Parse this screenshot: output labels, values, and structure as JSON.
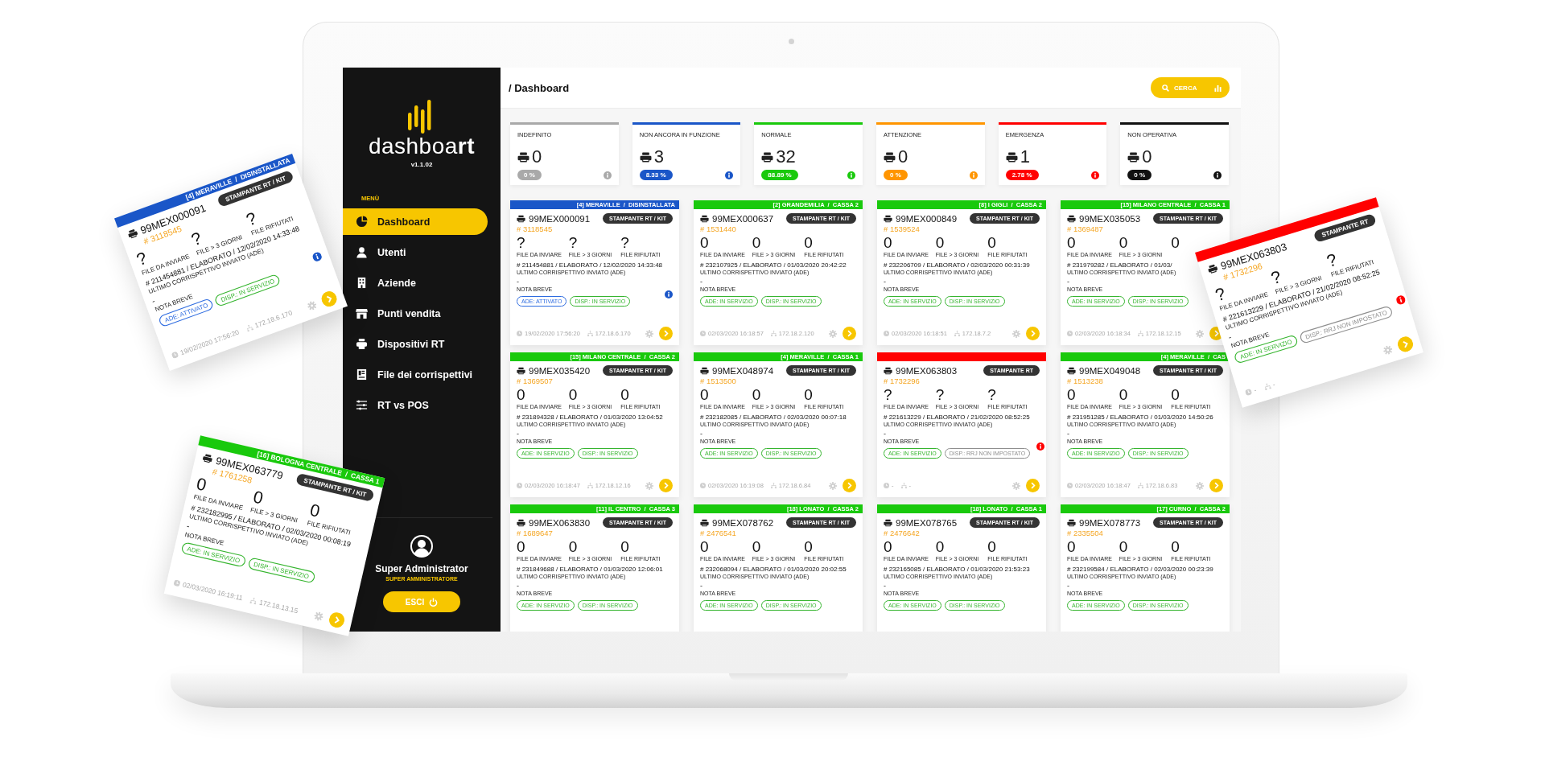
{
  "sidebar": {
    "logo": "dashboa**rt**",
    "version": "v1.1.02",
    "menu_label": "MENÙ",
    "items": [
      {
        "label": "Dashboard",
        "selected": true
      },
      {
        "label": "Utenti",
        "selected": false
      },
      {
        "label": "Aziende",
        "selected": false
      },
      {
        "label": "Punti vendita",
        "selected": false
      },
      {
        "label": "Dispositivi RT",
        "selected": false
      },
      {
        "label": "File dei corrispettivi",
        "selected": false
      },
      {
        "label": "RT vs POS",
        "selected": false
      }
    ],
    "user": {
      "name": "Super Administrator",
      "role": "SUPER AMMINISTRATORE"
    },
    "logout": "ESCI"
  },
  "header": {
    "breadcrumb": "/ Dashboard",
    "search_button": "CERCA"
  },
  "status_summary": [
    {
      "label": "INDEFINITO",
      "count": "0",
      "percent": "0 %",
      "color": "#a9a9a9"
    },
    {
      "label": "NON ANCORA IN FUNZIONE",
      "count": "3",
      "percent": "8.33 %",
      "color": "#1a56c8"
    },
    {
      "label": "NORMALE",
      "count": "32",
      "percent": "88.89 %",
      "color": "#19c90c"
    },
    {
      "label": "ATTENZIONE",
      "count": "0",
      "percent": "0 %",
      "color": "#ff9500"
    },
    {
      "label": "EMERGENZA",
      "count": "1",
      "percent": "2.78 %",
      "color": "#ff0000"
    },
    {
      "label": "NON OPERATIVA",
      "count": "0",
      "percent": "0 %",
      "color": "#111111"
    }
  ],
  "devices": [
    {
      "location": "[4] MERAVILLE  /  DISINSTALLATA",
      "color": "#1a56c8",
      "serial": "99MEX000091",
      "type": "STAMPANTE RT / KIT",
      "order": "# 3118545",
      "counters": [
        {
          "value": "?",
          "label": "FILE DA INVIARE"
        },
        {
          "value": "?",
          "label": "FILE > 3 GIORNI"
        },
        {
          "value": "?",
          "label": "FILE RIFIUTATI"
        }
      ],
      "last_file": "# 211454881 / ELABORATO / 12/02/2020 14:33:48",
      "last_file_label": "ULTIMO CORRISPETTIVO INVIATO (ADE)",
      "note": "-",
      "note_label": "NOTA BREVE",
      "ade": {
        "text": "ADE: ATTIVATO",
        "color": "#2d6be0"
      },
      "disp": {
        "text": "DISP.: IN SERVIZIO",
        "color": "#36b52f"
      },
      "alert": {
        "color": "#1a56c8"
      },
      "timestamp": "19/02/2020 17:56:20",
      "ip": "172.18.6.170"
    },
    {
      "location": "[2] GRANDEMILIA  /  CASSA 2",
      "color": "#19c90c",
      "serial": "99MEX000637",
      "type": "STAMPANTE RT / KIT",
      "order": "# 1531440",
      "counters": [
        {
          "value": "0",
          "label": "FILE DA INVIARE"
        },
        {
          "value": "0",
          "label": "FILE > 3 GIORNI"
        },
        {
          "value": "0",
          "label": "FILE RIFIUTATI"
        }
      ],
      "last_file": "# 232107925 / ELABORATO / 01/03/2020 20:42:22",
      "last_file_label": "ULTIMO CORRISPETTIVO INVIATO (ADE)",
      "note": "-",
      "note_label": "NOTA BREVE",
      "ade": {
        "text": "ADE: IN SERVIZIO",
        "color": "#36b52f"
      },
      "disp": {
        "text": "DISP.: IN SERVIZIO",
        "color": "#36b52f"
      },
      "timestamp": "02/03/2020 16:18:57",
      "ip": "172.18.2.120"
    },
    {
      "location": "[8] I GIGLI  /  CASSA 2",
      "color": "#19c90c",
      "serial": "99MEX000849",
      "type": "STAMPANTE RT / KIT",
      "order": "# 1539524",
      "counters": [
        {
          "value": "0",
          "label": "FILE DA INVIARE"
        },
        {
          "value": "0",
          "label": "FILE > 3 GIORNI"
        },
        {
          "value": "0",
          "label": "FILE RIFIUTATI"
        }
      ],
      "last_file": "# 232206709 / ELABORATO / 02/03/2020 00:31:39",
      "last_file_label": "ULTIMO CORRISPETTIVO INVIATO (ADE)",
      "note": "-",
      "note_label": "NOTA BREVE",
      "ade": {
        "text": "ADE: IN SERVIZIO",
        "color": "#36b52f"
      },
      "disp": {
        "text": "DISP.: IN SERVIZIO",
        "color": "#36b52f"
      },
      "timestamp": "02/03/2020 16:18:51",
      "ip": "172.18.7.2"
    },
    {
      "location": "[15] MILANO CENTRALE  /  CASSA 1",
      "color": "#19c90c",
      "serial": "99MEX035053",
      "type": "STAMPANTE RT / KIT",
      "order": "# 1369487",
      "counters": [
        {
          "value": "0",
          "label": "FILE DA INVIARE"
        },
        {
          "value": "0",
          "label": "FILE > 3 GIORNI"
        },
        {
          "value": "0"
        }
      ],
      "last_file": "# 231979282 / ELABORATO / 01/03/",
      "last_file_label": "ULTIMO CORRISPETTIVO INVIATO (ADE)",
      "note": "-",
      "note_label": "NOTA BREVE",
      "ade": {
        "text": "ADE: IN SERVIZIO",
        "color": "#36b52f"
      },
      "disp": {
        "text": "DISP.: IN SERVIZIO",
        "color": "#36b52f"
      },
      "timestamp": "02/03/2020 16:18:34",
      "ip": "172.18.12.15"
    },
    {
      "location": "[15] MILANO CENTRALE  /  CASSA 2",
      "color": "#19c90c",
      "serial": "99MEX035420",
      "type": "STAMPANTE RT / KIT",
      "order": "# 1369507",
      "counters": [
        {
          "value": "0",
          "label": "FILE DA INVIARE"
        },
        {
          "value": "0",
          "label": "FILE > 3 GIORNI"
        },
        {
          "value": "0",
          "label": "FILE RIFIUTATI"
        }
      ],
      "last_file": "# 231894328 / ELABORATO / 01/03/2020 13:04:52",
      "last_file_label": "ULTIMO CORRISPETTIVO INVIATO (ADE)",
      "note": "-",
      "note_label": "NOTA BREVE",
      "ade": {
        "text": "ADE: IN SERVIZIO",
        "color": "#36b52f"
      },
      "disp": {
        "text": "DISP.: IN SERVIZIO",
        "color": "#36b52f"
      },
      "timestamp": "02/03/2020 16:18:47",
      "ip": "172.18.12.16"
    },
    {
      "location": "[4] MERAVILLE  /  CASSA 1",
      "color": "#19c90c",
      "serial": "99MEX048974",
      "type": "STAMPANTE RT / KIT",
      "order": "# 1513500",
      "counters": [
        {
          "value": "0",
          "label": "FILE DA INVIARE"
        },
        {
          "value": "0",
          "label": "FILE > 3 GIORNI"
        },
        {
          "value": "0",
          "label": "FILE RIFIUTATI"
        }
      ],
      "last_file": "# 232182085 / ELABORATO / 02/03/2020 00:07:18",
      "last_file_label": "ULTIMO CORRISPETTIVO INVIATO (ADE)",
      "note": "-",
      "note_label": "NOTA BREVE",
      "ade": {
        "text": "ADE: IN SERVIZIO",
        "color": "#36b52f"
      },
      "disp": {
        "text": "DISP.: IN SERVIZIO",
        "color": "#36b52f"
      },
      "timestamp": "02/03/2020 16:19:08",
      "ip": "172.18.6.84"
    },
    {
      "color": "#ff0000",
      "serial": "99MEX063803",
      "type": "STAMPANTE RT",
      "order": "# 1732296",
      "counters": [
        {
          "value": "?",
          "label": "FILE DA INVIARE"
        },
        {
          "value": "?",
          "label": "FILE > 3 GIORNI"
        },
        {
          "value": "?",
          "label": "FILE RIFIUTATI"
        }
      ],
      "last_file": "# 221613229 / ELABORATO / 21/02/2020 08:52:25",
      "last_file_label": "ULTIMO CORRISPETTIVO INVIATO (ADE)",
      "note": "-",
      "note_label": "NOTA BREVE",
      "ade": {
        "text": "ADE: IN SERVIZIO",
        "color": "#36b52f"
      },
      "disp": {
        "text": "DISP.: RRJ NON IMPOSTATO",
        "color": "#8f8f8f"
      },
      "alert": {
        "color": "#ff0000"
      },
      "timestamp": "-",
      "ip": "-"
    },
    {
      "location": "[4] MERAVILLE  /  CAS",
      "color": "#19c90c",
      "serial": "99MEX049048",
      "type": "STAMPANTE RT / KIT",
      "order": "# 1513238",
      "counters": [
        {
          "value": "0",
          "label": "FILE DA INVIARE"
        },
        {
          "value": "0",
          "label": "FILE > 3 GIORNI"
        },
        {
          "value": "0",
          "label": "FILE RIFIUTATI"
        }
      ],
      "last_file": "# 231951285 / ELABORATO / 01/03/2020 14:50:26",
      "last_file_label": "ULTIMO CORRISPETTIVO INVIATO (ADE)",
      "note": "-",
      "note_label": "NOTA BREVE",
      "ade": {
        "text": "ADE: IN SERVIZIO",
        "color": "#36b52f"
      },
      "disp": {
        "text": "DISP.: IN SERVIZIO",
        "color": "#36b52f"
      },
      "timestamp": "02/03/2020 16:18:47",
      "ip": "172.18.6.83"
    },
    {
      "location": "[11] IL CENTRO  /  CASSA 3",
      "color": "#19c90c",
      "serial": "99MEX063830",
      "type": "STAMPANTE RT / KIT",
      "order": "# 1689647",
      "counters": [
        {
          "value": "0",
          "label": "FILE DA INVIARE"
        },
        {
          "value": "0",
          "label": "FILE > 3 GIORNI"
        },
        {
          "value": "0",
          "label": "FILE RIFIUTATI"
        }
      ],
      "last_file": "# 231849688 / ELABORATO / 01/03/2020 12:06:01",
      "last_file_label": "ULTIMO CORRISPETTIVO INVIATO (ADE)",
      "note": "-",
      "note_label": "NOTA BREVE",
      "ade": {
        "text": "ADE: IN SERVIZIO",
        "color": "#36b52f"
      },
      "disp": {
        "text": "DISP.: IN SERVIZIO",
        "color": "#36b52f"
      }
    },
    {
      "location": "[18] LONATO  /  CASSA 2",
      "color": "#19c90c",
      "serial": "99MEX078762",
      "type": "STAMPANTE RT / KIT",
      "order": "# 2476541",
      "counters": [
        {
          "value": "0",
          "label": "FILE DA INVIARE"
        },
        {
          "value": "0",
          "label": "FILE > 3 GIORNI"
        },
        {
          "value": "0",
          "label": "FILE RIFIUTATI"
        }
      ],
      "last_file": "# 232068094 / ELABORATO / 01/03/2020 20:02:55",
      "last_file_label": "ULTIMO CORRISPETTIVO INVIATO (ADE)",
      "note": "-",
      "note_label": "NOTA BREVE",
      "ade": {
        "text": "ADE: IN SERVIZIO",
        "color": "#36b52f"
      },
      "disp": {
        "text": "DISP.: IN SERVIZIO",
        "color": "#36b52f"
      }
    },
    {
      "location": "[18] LONATO  /  CASSA 1",
      "color": "#19c90c",
      "serial": "99MEX078765",
      "type": "STAMPANTE RT / KIT",
      "order": "# 2476642",
      "counters": [
        {
          "value": "0",
          "label": "FILE DA INVIARE"
        },
        {
          "value": "0",
          "label": "FILE > 3 GIORNI"
        },
        {
          "value": "0",
          "label": "FILE RIFIUTATI"
        }
      ],
      "last_file": "# 232165085 / ELABORATO / 01/03/2020 21:53:23",
      "last_file_label": "ULTIMO CORRISPETTIVO INVIATO (ADE)",
      "note": "-",
      "note_label": "NOTA BREVE",
      "ade": {
        "text": "ADE: IN SERVIZIO",
        "color": "#36b52f"
      },
      "disp": {
        "text": "DISP.: IN SERVIZIO",
        "color": "#36b52f"
      }
    },
    {
      "location": "[17] CURNO  /  CASSA 2",
      "color": "#19c90c",
      "serial": "99MEX078773",
      "type": "STAMPANTE RT / KIT",
      "order": "# 2335504",
      "counters": [
        {
          "value": "0",
          "label": "FILE DA INVIARE"
        },
        {
          "value": "0",
          "label": "FILE > 3 GIORNI"
        },
        {
          "value": "0",
          "label": "FILE RIFIUTATI"
        }
      ],
      "last_file": "# 232199584 / ELABORATO / 02/03/2020 00:23:39",
      "last_file_label": "ULTIMO CORRISPETTIVO INVIATO (ADE)",
      "note": "-",
      "note_label": "NOTA BREVE",
      "ade": {
        "text": "ADE: IN SERVIZIO",
        "color": "#36b52f"
      },
      "disp": {
        "text": "DISP.: IN SERVIZIO",
        "color": "#36b52f"
      }
    }
  ],
  "floating_cards": [
    {
      "location": "[4] MERAVILLE  /  DISINSTALLATA",
      "color": "#1a56c8",
      "serial": "99MEX000091",
      "type": "STAMPANTE RT / KIT",
      "order": "# 3118545",
      "counters": [
        {
          "value": "?",
          "label": "FILE DA INVIARE"
        },
        {
          "value": "?",
          "label": "FILE > 3 GIORNI"
        },
        {
          "value": "?",
          "label": "FILE RIFIUTATI"
        }
      ],
      "last_file": "# 211454881 / ELABORATO / 12/02/2020 14:33:48",
      "last_file_label": "ULTIMO CORRISPETTIVO INVIATO (ADE)",
      "note": "-",
      "note_label": "NOTA BREVE",
      "ade": {
        "text": "ADE: ATTIVATO",
        "color": "#2d6be0"
      },
      "disp": {
        "text": "DISP.: IN SERVIZIO",
        "color": "#36b52f"
      },
      "alert": {
        "color": "#1a56c8"
      },
      "timestamp": "19/02/2020 17:56:20",
      "ip": "172.18.6.170"
    },
    {
      "location": "[16] BOLOGNA CENTRALE  /  CASSA 1",
      "color": "#19c90c",
      "serial": "99MEX063779",
      "type": "STAMPANTE RT / KIT",
      "order": "# 1761258",
      "counters": [
        {
          "value": "0",
          "label": "FILE DA INVIARE"
        },
        {
          "value": "0",
          "label": "FILE > 3 GIORNI"
        },
        {
          "value": "0",
          "label": "FILE RIFIUTATI"
        }
      ],
      "last_file": "# 232182995 / ELABORATO / 02/03/2020 00:08:19",
      "last_file_label": "ULTIMO CORRISPETTIVO INVIATO (ADE)",
      "note": "-",
      "note_label": "NOTA BREVE",
      "ade": {
        "text": "ADE: IN SERVIZIO",
        "color": "#36b52f"
      },
      "disp": {
        "text": "DISP.: IN SERVIZIO",
        "color": "#36b52f"
      },
      "timestamp": "02/03/2020 16:19:11",
      "ip": "172.18.13.15"
    },
    {
      "color": "#ff0000",
      "serial": "99MEX063803",
      "type": "STAMPANTE RT",
      "order": "# 1732296",
      "counters": [
        {
          "value": "?",
          "label": "FILE DA INVIARE"
        },
        {
          "value": "?",
          "label": "FILE > 3 GIORNI"
        },
        {
          "value": "?",
          "label": "FILE RIFIUTATI"
        }
      ],
      "last_file": "# 221613229 / ELABORATO / 21/02/2020 08:52:25",
      "last_file_label": "ULTIMO CORRISPETTIVO INVIATO (ADE)",
      "note": "-",
      "note_label": "NOTA BREVE",
      "ade": {
        "text": "ADE: IN SERVIZIO",
        "color": "#36b52f"
      },
      "disp": {
        "text": "DISP.: RRJ NON IMPOSTATO",
        "color": "#8f8f8f"
      },
      "alert": {
        "color": "#ff0000"
      },
      "timestamp": "-",
      "ip": "-"
    }
  ]
}
